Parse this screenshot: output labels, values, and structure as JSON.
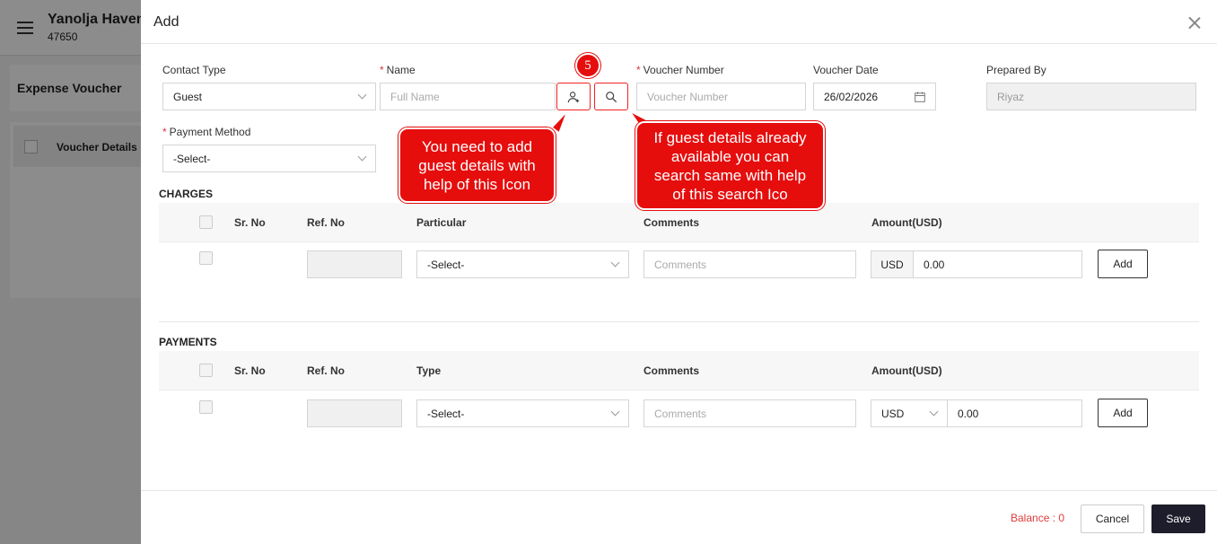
{
  "background": {
    "hotel_name": "Yanolja Haven",
    "hotel_id": "47650",
    "card_title": "Expense Voucher",
    "list_header": "Voucher Details"
  },
  "modal": {
    "title": "Add",
    "contact_type": {
      "label": "Contact Type",
      "value": "Guest"
    },
    "name": {
      "label": "Name",
      "placeholder": "Full Name"
    },
    "voucher_number": {
      "label": "Voucher Number",
      "placeholder": "Voucher Number"
    },
    "voucher_date": {
      "label": "Voucher Date",
      "value": "26/02/2026"
    },
    "prepared_by": {
      "label": "Prepared By",
      "value": "Riyaz"
    },
    "payment_method": {
      "label": "Payment Method",
      "value": "-Select-"
    },
    "charges": {
      "title": "CHARGES",
      "columns": [
        "Sr. No",
        "Ref. No",
        "Particular",
        "Comments",
        "Amount(USD)"
      ],
      "row": {
        "particular": "-Select-",
        "comments_placeholder": "Comments",
        "currency": "USD",
        "amount": "0.00",
        "add_label": "Add"
      }
    },
    "payments": {
      "title": "PAYMENTS",
      "columns": [
        "Sr. No",
        "Ref. No",
        "Type",
        "Comments",
        "Amount(USD)"
      ],
      "row": {
        "type": "-Select-",
        "comments_placeholder": "Comments",
        "currency": "USD",
        "amount": "0.00",
        "add_label": "Add"
      }
    },
    "footer": {
      "balance": "Balance : 0",
      "cancel": "Cancel",
      "save": "Save"
    }
  },
  "annotations": {
    "badge": "5",
    "callout_add": "You need to add guest details with help of this Icon",
    "callout_search": "If guest details already available you can search same with help of this search Ico"
  },
  "colors": {
    "accent": "#e60d0d",
    "save_button": "#1d1d2b",
    "balance": "#e23b3b"
  }
}
